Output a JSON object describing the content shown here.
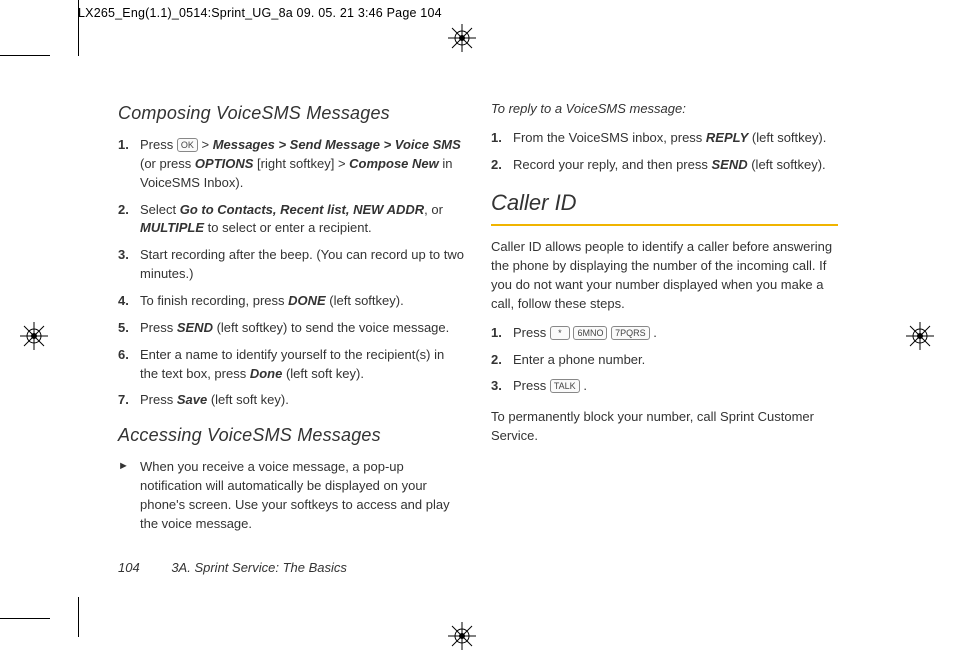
{
  "runhead": "LX265_Eng(1.1)_0514:Sprint_UG_8a  09. 05. 21     3:46  Page 104",
  "left": {
    "h1": "Composing VoiceSMS Messages",
    "steps": [
      {
        "pre": "Press ",
        "key": "OK",
        "mid": " > ",
        "p1": "Messages > Send Message > Voice SMS",
        "post1": " (or press ",
        "p2": "OPTIONS",
        "post2": " [right softkey] > ",
        "p3": "Compose New",
        "post3": " in VoiceSMS Inbox)."
      },
      {
        "pre": "Select ",
        "p1": "Go to Contacts, Recent list, NEW ADDR",
        "post1": ", or ",
        "p2": "MULTIPLE",
        "post2": " to select or enter a recipient."
      },
      {
        "text": "Start recording after the beep. (You can record up to two minutes.)"
      },
      {
        "pre": "To finish recording, press ",
        "p1": "DONE",
        "post1": " (left softkey)."
      },
      {
        "pre": "Press ",
        "p1": "SEND",
        "post1": " (left softkey) to send the voice message."
      },
      {
        "pre": "Enter a name to identify yourself to the recipient(s) in the text box, press ",
        "p1": "Done",
        "post1": " (left soft key)."
      },
      {
        "pre": "Press ",
        "p1": "Save",
        "post1": " (left soft key)."
      }
    ],
    "h2": "Accessing VoiceSMS Messages",
    "bullet": "When you receive a voice message, a pop-up notification will automatically be displayed on your phone's screen. Use your softkeys to access and play the voice message."
  },
  "right": {
    "intro": "To reply to a VoiceSMS message:",
    "replySteps": [
      {
        "pre": "From the VoiceSMS inbox, press ",
        "p1": "REPLY",
        "post1": " (left softkey)."
      },
      {
        "pre": "Record your reply, and then press ",
        "p1": "SEND",
        "post1": " (left softkey)."
      }
    ],
    "h1": "Caller ID",
    "para": "Caller ID allows people to identify a caller before answering the phone by displaying the number of the incoming call. If you do not want your number displayed when you make a call, follow these steps.",
    "cidSteps": [
      {
        "pre": "Press ",
        "keys": [
          "*",
          "6MNO",
          "7PQRS"
        ],
        "post": "."
      },
      {
        "text": "Enter a phone number."
      },
      {
        "pre": "Press ",
        "keys": [
          "TALK"
        ],
        "post": "."
      }
    ],
    "para2": "To permanently block your number, call Sprint Customer Service."
  },
  "footer": {
    "page": "104",
    "section": "3A. Sprint Service: The Basics"
  }
}
